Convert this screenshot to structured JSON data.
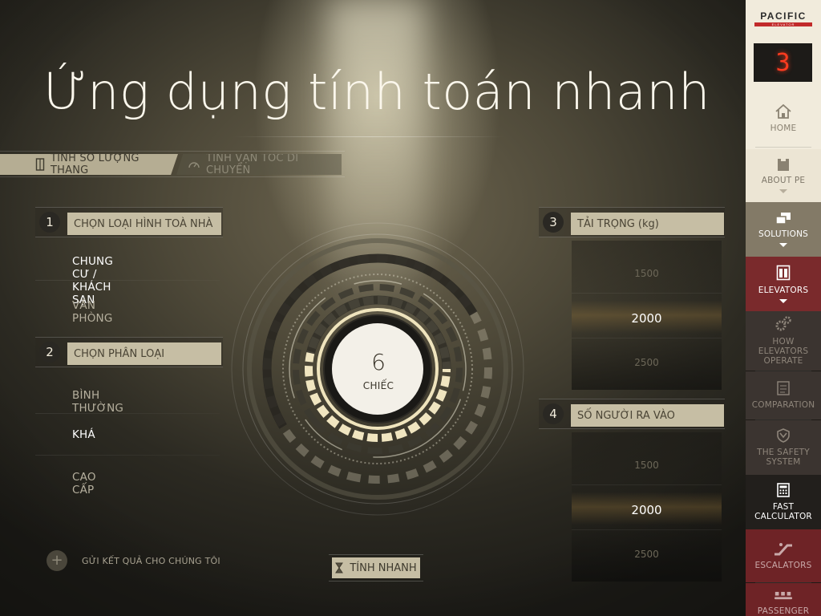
{
  "title": "Ứng dụng tính toán nhanh",
  "tabs": [
    {
      "label": "TÍNH SỐ LƯỢNG THANG",
      "icon": "elevator-icon",
      "active": true
    },
    {
      "label": "TÍNH VẬN TỐC DI CHUYỂN",
      "icon": "speedometer-icon",
      "active": false
    }
  ],
  "step1": {
    "number": "1",
    "heading": "CHỌN LOẠI HÌNH TOÀ NHÀ",
    "options": [
      {
        "label": "CHUNG CƯ / KHÁCH SẠN",
        "selected": true
      },
      {
        "label": "VĂN PHÒNG",
        "selected": false
      }
    ]
  },
  "step2": {
    "number": "2",
    "heading": "CHỌN PHÂN LOẠI",
    "options": [
      {
        "label": "BÌNH THƯỜNG",
        "selected": false
      },
      {
        "label": "KHÁ",
        "selected": true
      },
      {
        "label": "CAO CẤP",
        "selected": false
      }
    ]
  },
  "step3": {
    "number": "3",
    "heading": "TẢI TRỌNG (kg)",
    "values": [
      "1500",
      "2000",
      "2500"
    ],
    "selected": "2000"
  },
  "step4": {
    "number": "4",
    "heading": "SỐ NGƯỜI RA VÀO",
    "values": [
      "1500",
      "2000",
      "2500"
    ],
    "selected": "2000"
  },
  "result": {
    "value": "6",
    "unit": "CHIẾC"
  },
  "send_label": "GỬI KẾT QUẢ CHO CHÚNG TÔI",
  "calc_label": "TÍNH NHANH",
  "sidebar": {
    "logo": "PACIFIC",
    "logo_sub": "ELEVATOR",
    "floor": "3",
    "items": [
      {
        "label": "HOME",
        "icon": "home-icon",
        "bg": "#f1ebdc",
        "color": "#8a8272"
      },
      {
        "label": "ABOUT PE",
        "icon": "building-icon",
        "bg": "#ece5d4",
        "color": "#7f786a"
      },
      {
        "label": "SOLUTIONS",
        "icon": "layers-icon",
        "bg": "#837a67",
        "color": "#ffffff"
      },
      {
        "label": "ELEVATORS",
        "icon": "elevator-doors-icon",
        "bg": "#7a2a2c",
        "color": "#ffffff"
      },
      {
        "label": "HOW ELEVATORS OPERATE",
        "icon": "gears-icon",
        "bg": "#3b3430",
        "color": "#8e857a"
      },
      {
        "label": "COMPARATION",
        "icon": "checklist-icon",
        "bg": "#3b3430",
        "color": "#8e857a"
      },
      {
        "label": "THE SAFETY SYSTEM",
        "icon": "shield-icon",
        "bg": "#3b3430",
        "color": "#8e857a"
      },
      {
        "label": "FAST CALCULATOR",
        "icon": "calculator-icon",
        "bg": "#221f1c",
        "color": "#ffffff"
      },
      {
        "label": "ESCALATORS",
        "icon": "escalator-icon",
        "bg": "#6e2326",
        "color": "#c9a9a9"
      },
      {
        "label": "PASSENGER",
        "icon": "conveyor-icon",
        "bg": "#6e2326",
        "color": "#c9a9a9"
      }
    ]
  }
}
